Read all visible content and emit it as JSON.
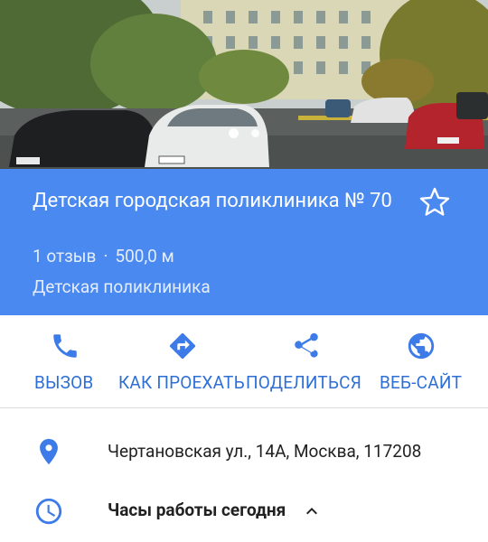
{
  "photo": {
    "description_icon": "photo-gallery",
    "page_dots": 2
  },
  "place": {
    "title": "Детская городская поликлиника № 70",
    "reviews": "1 отзыв",
    "separator": "·",
    "distance": "500,0 м",
    "category": "Детская поликлиника",
    "header_color": "#4a89ef"
  },
  "actions": [
    {
      "label": "ВЫЗОВ",
      "icon": "phone-icon"
    },
    {
      "label": "КАК ПРОЕХАТЬ",
      "icon": "directions-icon"
    },
    {
      "label": "ПОДЕЛИТЬСЯ",
      "icon": "share-icon"
    },
    {
      "label": "ВЕБ-САЙТ",
      "icon": "globe-icon"
    }
  ],
  "details": {
    "address": "Чертановская ул., 14А, Москва, 117208",
    "hours_label": "Часы работы сегодня"
  },
  "colors": {
    "accent": "#2e6fd6",
    "icon_blue": "#3d7be8"
  }
}
